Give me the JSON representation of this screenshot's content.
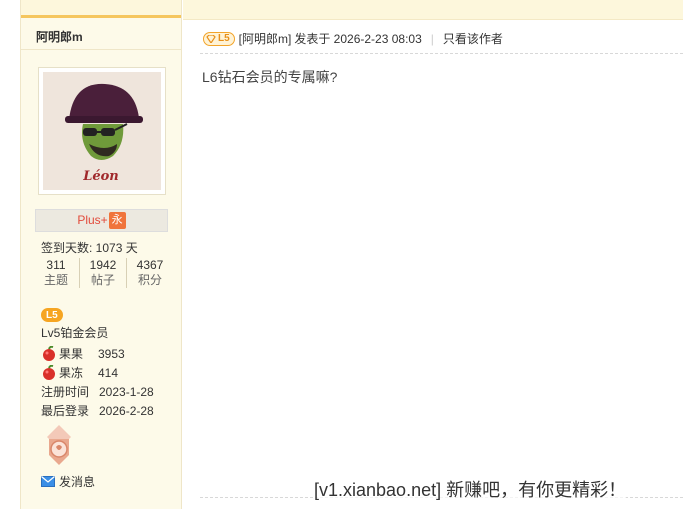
{
  "profile": {
    "username": "阿明郎m",
    "avatar_caption": "Léon",
    "group": "Plus+",
    "group_tag": "永",
    "signin": "签到天数: 1073 天",
    "stats": [
      {
        "value": "311",
        "label": "主题"
      },
      {
        "value": "1942",
        "label": "帖子"
      },
      {
        "value": "4367",
        "label": "积分"
      }
    ],
    "level_badge": "L5",
    "level_name": "Lv5铂金会员",
    "fruit_label": "果果",
    "fruit_value": "3953",
    "jelly_label": "果冻",
    "jelly_value": "414",
    "reg_label": "注册时间",
    "reg_value": "2023-1-28",
    "last_label": "最后登录",
    "last_value": "2026-2-28",
    "pm_label": "发消息"
  },
  "post": {
    "level_badge": "L5",
    "author": "[阿明郎m]",
    "posted_at": "发表于 2026-2-23 08:03",
    "only_author": "只看该作者",
    "content": "L6钻石会员的专属嘛?"
  },
  "watermark": "[v1.xianbao.net] 新赚吧，有你更精彩！",
  "colors": {
    "accent": "#f5c65e",
    "sidebar_bg": "#fdfae9",
    "badge": "#f6a522",
    "group_text": "#e24a3b"
  }
}
